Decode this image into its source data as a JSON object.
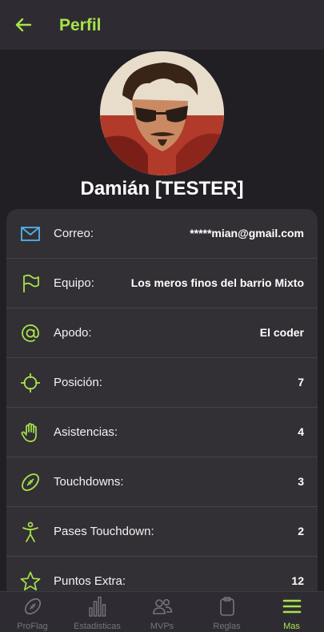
{
  "header": {
    "title": "Perfil",
    "back_icon": "arrow-left-icon"
  },
  "profile": {
    "name": "Damián [TESTER]",
    "avatar": "user-avatar-illustration"
  },
  "fields": [
    {
      "icon": "mail-icon",
      "label": "Correo:",
      "value": "*****mian@gmail.com"
    },
    {
      "icon": "flag-icon",
      "label": "Equipo:",
      "value": "Los meros finos del barrio Mixto"
    },
    {
      "icon": "at-icon",
      "label": "Apodo:",
      "value": "El coder"
    },
    {
      "icon": "crosshair-icon",
      "label": "Posición:",
      "value": "7"
    },
    {
      "icon": "hand-icon",
      "label": "Asistencias:",
      "value": "4"
    },
    {
      "icon": "football-icon",
      "label": "Touchdowns:",
      "value": "3"
    },
    {
      "icon": "person-arms-up-icon",
      "label": "Pases Touchdown:",
      "value": "2"
    },
    {
      "icon": "star-icon",
      "label": "Puntos Extra:",
      "value": "12"
    }
  ],
  "nav": [
    {
      "icon": "football-icon",
      "label": "ProFlag",
      "active": false
    },
    {
      "icon": "bar-chart-icon",
      "label": "Estadisticas",
      "active": false
    },
    {
      "icon": "users-icon",
      "label": "MVPs",
      "active": false
    },
    {
      "icon": "clipboard-icon",
      "label": "Reglas",
      "active": false
    },
    {
      "icon": "menu-icon",
      "label": "Mas",
      "active": true
    }
  ],
  "colors": {
    "accent": "#a6e34b",
    "mail_icon": "#4fb3e8",
    "background": "#211f24",
    "card": "#323035",
    "inactive_nav": "#77757b"
  }
}
